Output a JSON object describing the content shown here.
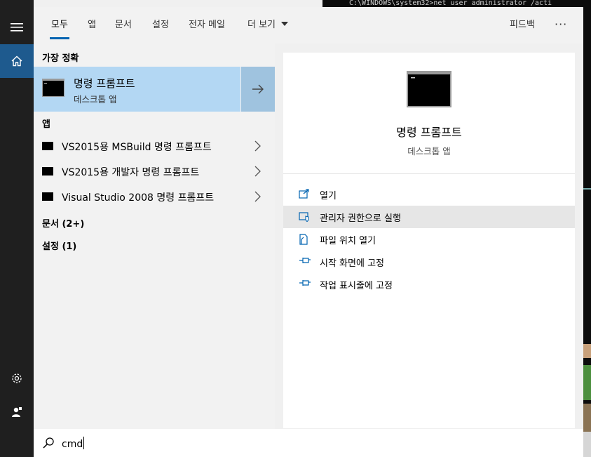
{
  "background": {
    "terminal_text": "C:\\WINDOWS\\system32>net user administrator /acti"
  },
  "tabs": [
    {
      "label": "모두",
      "active": true
    },
    {
      "label": "앱"
    },
    {
      "label": "문서"
    },
    {
      "label": "설정"
    },
    {
      "label": "전자 메일"
    },
    {
      "label": "더 보기"
    }
  ],
  "header": {
    "feedback": "피드백",
    "more": "···"
  },
  "results": {
    "best_match_heading": "가장 정확",
    "best_match": {
      "title": "명령 프롬프트",
      "subtitle": "데스크톱 앱"
    },
    "apps_heading": "앱",
    "apps": [
      {
        "label": "VS2015용 MSBuild 명령 프롬프트"
      },
      {
        "label": "VS2015용 개발자 명령 프롬프트"
      },
      {
        "label": "Visual Studio 2008 명령 프롬프트"
      }
    ],
    "documents_heading": "문서 (2+)",
    "settings_heading": "설정 (1)"
  },
  "preview": {
    "title": "명령 프롬프트",
    "subtitle": "데스크톱 앱",
    "actions": [
      {
        "label": "열기",
        "icon": "open-icon"
      },
      {
        "label": "관리자 권한으로 실행",
        "icon": "shield-icon",
        "highlighted": true
      },
      {
        "label": "파일 위치 열기",
        "icon": "file-location-icon"
      },
      {
        "label": "시작 화면에 고정",
        "icon": "pin-icon"
      },
      {
        "label": "작업 표시줄에 고정",
        "icon": "pin-icon"
      }
    ]
  },
  "search": {
    "value": "cmd"
  },
  "colors": {
    "accent": "#0063b1",
    "rail": "#1f1f1f",
    "home_active": "#1e5a8e",
    "best_match_bg": "#b3d7f3",
    "best_match_arrow_bg": "#9fc3df",
    "action_highlight": "#e6e6e6"
  }
}
